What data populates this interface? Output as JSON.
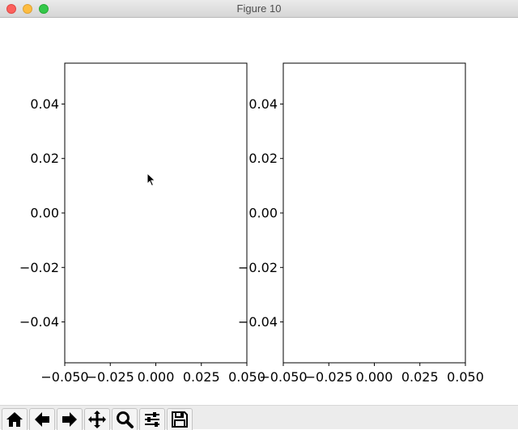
{
  "window": {
    "title": "Figure 10"
  },
  "toolbar": {
    "buttons": [
      {
        "name": "home-button",
        "icon": "home-icon"
      },
      {
        "name": "back-button",
        "icon": "arrow-left-icon"
      },
      {
        "name": "forward-button",
        "icon": "arrow-right-icon"
      },
      {
        "name": "pan-button",
        "icon": "move-icon"
      },
      {
        "name": "zoom-button",
        "icon": "magnifier-icon"
      },
      {
        "name": "configure-subplots-button",
        "icon": "sliders-icon"
      },
      {
        "name": "save-button",
        "icon": "floppy-disk-icon"
      }
    ]
  },
  "chart_data": [
    {
      "type": "scatter",
      "title": "",
      "xlabel": "",
      "ylabel": "",
      "xlim": [
        -0.05,
        0.05
      ],
      "ylim": [
        -0.055,
        0.055
      ],
      "xticks": [
        -0.05,
        -0.025,
        0.0,
        0.025,
        0.05
      ],
      "xtick_labels": [
        "−0.050",
        "−0.025",
        "0.000",
        "0.025",
        "0.050"
      ],
      "yticks": [
        0.04,
        0.02,
        0.0,
        -0.02,
        -0.04
      ],
      "ytick_labels": [
        "0.04",
        "0.02",
        "0.00",
        "−0.02",
        "−0.04"
      ],
      "grid": false,
      "series": []
    },
    {
      "type": "scatter",
      "title": "",
      "xlabel": "",
      "ylabel": "",
      "xlim": [
        -0.05,
        0.05
      ],
      "ylim": [
        -0.055,
        0.055
      ],
      "xticks": [
        -0.05,
        -0.025,
        0.0,
        0.025,
        0.05
      ],
      "xtick_labels": [
        "−0.050",
        "−0.025",
        "0.000",
        "0.025",
        "0.050"
      ],
      "yticks": [
        0.04,
        0.02,
        0.0,
        -0.02,
        -0.04
      ],
      "ytick_labels": [
        "0.04",
        "0.02",
        "0.00",
        "−0.02",
        "−0.04"
      ],
      "grid": false,
      "series": []
    }
  ]
}
